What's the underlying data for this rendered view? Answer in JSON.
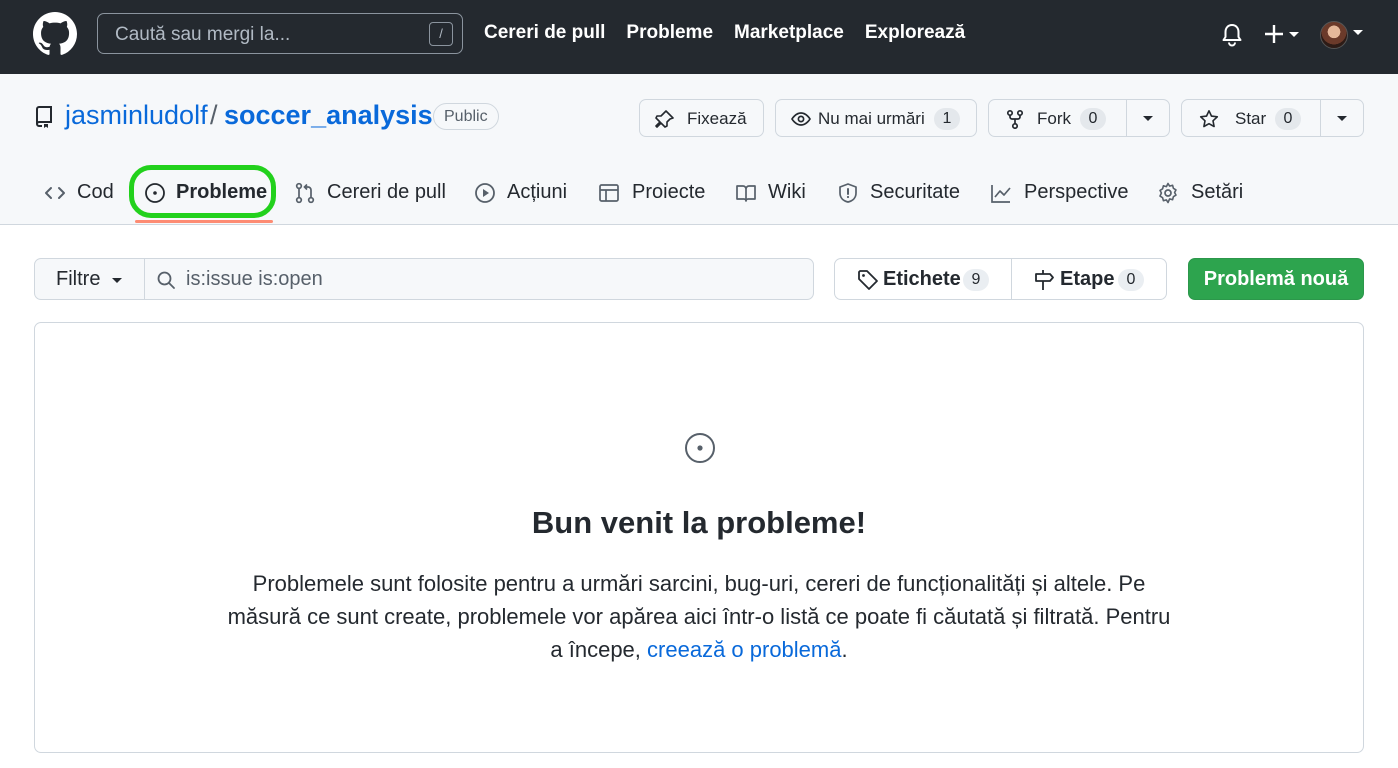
{
  "header": {
    "search_placeholder": "Caută sau mergi la...",
    "search_shortcut": "/",
    "nav": [
      "Cereri de pull",
      "Probleme",
      "Marketplace",
      "Explorează"
    ]
  },
  "repo": {
    "owner": "jasminludolf",
    "separator": "/",
    "name": "soccer_analysis",
    "visibility": "Public",
    "pin_label": "Fixează",
    "watch_label": "Nu mai urmări",
    "watch_count": "1",
    "fork_label": "Fork",
    "fork_count": "0",
    "star_label": "Star",
    "star_count": "0"
  },
  "tabs": [
    {
      "label": "Cod",
      "icon": "code-icon"
    },
    {
      "label": "Probleme",
      "icon": "issue-opened-icon",
      "active": true
    },
    {
      "label": "Cereri de pull",
      "icon": "git-pull-request-icon"
    },
    {
      "label": "Acțiuni",
      "icon": "play-icon"
    },
    {
      "label": "Proiecte",
      "icon": "table-icon"
    },
    {
      "label": "Wiki",
      "icon": "book-icon"
    },
    {
      "label": "Securitate",
      "icon": "shield-icon"
    },
    {
      "label": "Perspective",
      "icon": "graph-icon"
    },
    {
      "label": "Setări",
      "icon": "gear-icon"
    }
  ],
  "issues": {
    "filters_label": "Filtre",
    "search_value": "is:issue is:open",
    "labels_label": "Etichete",
    "labels_count": "9",
    "milestones_label": "Etape",
    "milestones_count": "0",
    "new_issue_label": "Problemă nouă"
  },
  "blankslate": {
    "title": "Bun venit la probleme!",
    "text": "Problemele sunt folosite pentru a urmări sarcini, bug-uri, cereri de funcționalități și altele. Pe măsură ce sunt create, problemele vor apărea aici într-o listă ce poate fi căutată și filtrată. Pentru a începe, ",
    "link": "creează o problemă",
    "end": "."
  },
  "colors": {
    "header_bg": "#24292f",
    "link": "#0969da",
    "primary_button": "#2da44e",
    "active_tab_underline": "#fd8c73",
    "highlight_ring": "#22d11c"
  }
}
